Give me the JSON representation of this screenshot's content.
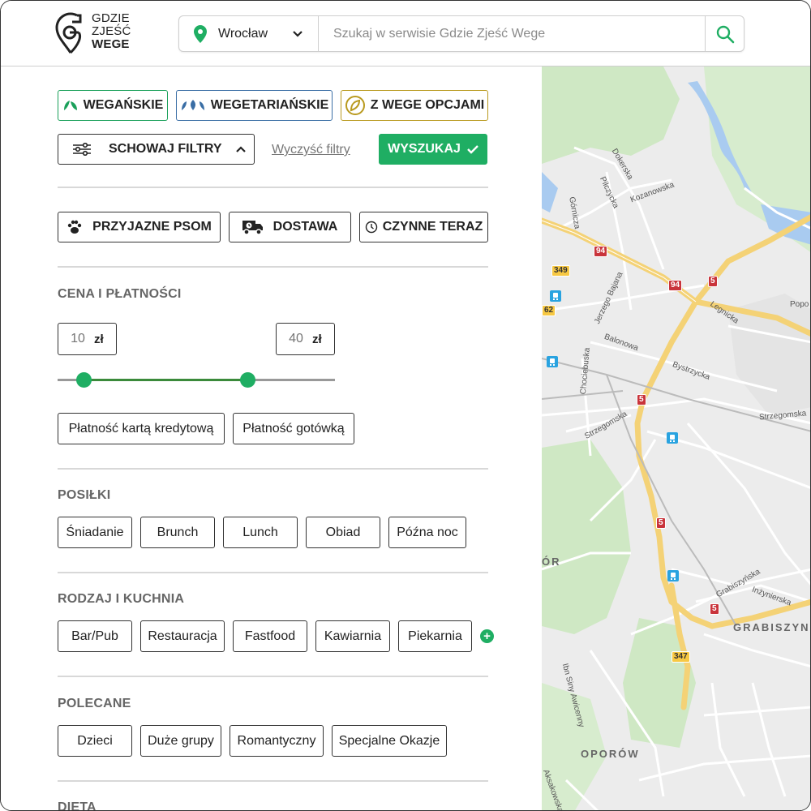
{
  "logo": {
    "line1": "GDZIE",
    "line2": "ZJEŚĆ",
    "line3": "WEGE"
  },
  "search": {
    "city": "Wrocław",
    "placeholder": "Szukaj w serwisie Gdzie Zjeść Wege"
  },
  "diet_buttons": {
    "vegan": "WEGAŃSKIE",
    "vegetarian": "WEGETARIAŃSKIE",
    "options": "Z WEGE OPCJAMI"
  },
  "filters": {
    "toggle": "SCHOWAJ FILTRY",
    "clear": "Wyczyść filtry",
    "submit": "WYSZUKAJ"
  },
  "features": {
    "dogs": "PRZYJAZNE PSOM",
    "delivery": "DOSTAWA",
    "open_now": "CZYNNE TERAZ"
  },
  "price": {
    "title": "CENA I PŁATNOŚCI",
    "min": "10",
    "max": "40",
    "currency": "zł",
    "payments": [
      "Płatność kartą kredytową",
      "Płatność gotówką"
    ]
  },
  "meals": {
    "title": "POSIŁKI",
    "items": [
      "Śniadanie",
      "Brunch",
      "Lunch",
      "Obiad",
      "Późna noc"
    ]
  },
  "kind": {
    "title": "RODZAJ I KUCHNIA",
    "items": [
      "Bar/Pub",
      "Restauracja",
      "Fastfood",
      "Kawiarnia",
      "Piekarnia"
    ],
    "more": "+"
  },
  "recommended": {
    "title": "POLECANE",
    "items": [
      "Dzieci",
      "Duże grupy",
      "Romantyczny",
      "Specjalne Okazje"
    ]
  },
  "diet": {
    "title": "DIETA"
  },
  "map": {
    "streets": [
      "Dokerska",
      "Pilczycka",
      "Kozanowska",
      "Górnicza",
      "Jerzego Bajana",
      "Legnicka",
      "Popo",
      "Balonowa",
      "Bystrzycka",
      "Chociebuska",
      "Strzegomska",
      "Strzegomska",
      "Grabiszyńska",
      "Inżynierska",
      "Ibn Siny Awicenny",
      "Aksakowska"
    ],
    "districts": [
      "GRABISZYN",
      "OPORÓW",
      "ÓR"
    ],
    "roads": [
      "94",
      "94",
      "349",
      "5",
      "62",
      "5",
      "5",
      "5",
      "347"
    ]
  },
  "colors": {
    "brand_green": "#1fae63",
    "vegan": "#1aa05a",
    "vegetarian": "#3a6ea5",
    "options": "#b99a1f"
  }
}
